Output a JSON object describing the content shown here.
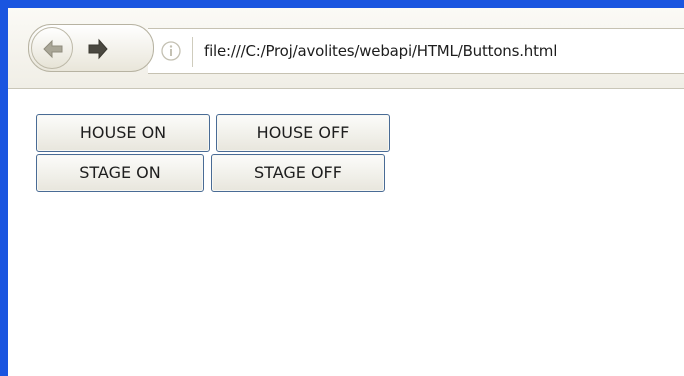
{
  "browser": {
    "url": "file:///C:/Proj/avolites/webapi/HTML/Buttons.html",
    "icons": {
      "back": "back-arrow-icon",
      "forward": "forward-arrow-icon",
      "info": "info-icon"
    }
  },
  "page": {
    "buttons": [
      {
        "label": "HOUSE ON"
      },
      {
        "label": "HOUSE OFF"
      },
      {
        "label": "STAGE ON"
      },
      {
        "label": "STAGE OFF"
      }
    ]
  },
  "colors": {
    "window_border": "#1a55e0",
    "button_border": "#496b95"
  }
}
